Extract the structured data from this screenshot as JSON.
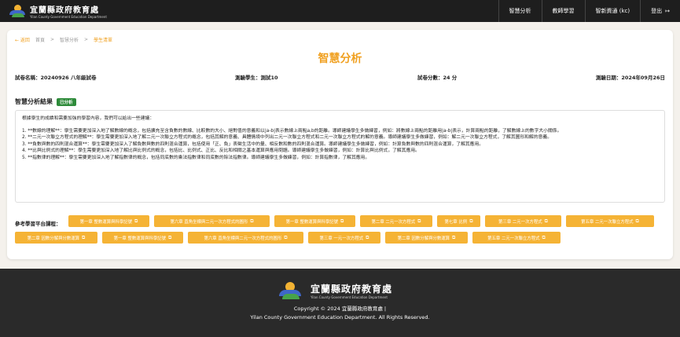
{
  "header": {
    "logo_zh": "宜蘭縣政府教育處",
    "logo_en": "Yilan County Government Education Department",
    "nav": [
      {
        "label": "智慧分析"
      },
      {
        "label": "教師學習"
      },
      {
        "label": "智新資通 (kc)"
      },
      {
        "label": "登出"
      }
    ],
    "logout_icon": "↦"
  },
  "breadcrumb": {
    "back": "← 返回",
    "items": [
      "首頁",
      ">",
      "智慧分析",
      ">",
      "學生清單"
    ]
  },
  "page_title": "智慧分析",
  "meta": {
    "exam_name": "試卷名稱：20240926 八年級試卷",
    "student": "測驗學生：測試10",
    "score": "試卷分數：24 分",
    "date": "測驗日期：2024年09月26日"
  },
  "analysis": {
    "heading": "智慧分析結果",
    "badge": "已分析",
    "intro": "根據學生的成績和需要加強的學習內容，我們可以給出一些建議：",
    "items": [
      "1. **數線的理解**：學生需要更加深入地了解數線的概念，包括擴充至含負數的數線、比較數的大小、絕對值的意義和以|a-b|表示數線上兩點a,b的距離。導師建議學生多做練習，例如：將數線上兩點的距離用|a-b|表示，計算兩點的距離，了解數線上的數字大小關係。",
      "2. **二元一次聯立方程式的理解**：學生需要更加深入地了解二元一次聯立方程式的概念，包括其解的意義、具體情境中列出二元一次聯立方程式和二元一次聯立方程式的解的意義。導師建議學生多做練習，例如：解二元一次聯立方程式，了解其圖形和解的意義。",
      "3. **負數與數的四則混合運算**：學生需要更加深入了解負數與數的四則混合運算，包括使用「正、負」表徵生活中的量、相反數和數的四則混合運算。導師建議學生多做練習，例如：計算負數與數的四則混合運算，了解其應用。",
      "4. **比與比例式的理解**：學生需要更加深入地了解比與比例式的概念，包括比、比例式、正比、反比和相關之基本運算與應用問題。導師建議學生多做練習，例如：計算比與比例式，了解其應用。",
      "5. **指數律的理解**：學生需要更加深入地了解指數律的概念，包括同底數的乘法指數律和同底數的除法指數律。導師建議學生多做練習，例如：計算指數律，了解其應用。"
    ]
  },
  "references": {
    "label": "參考學習平台課程：",
    "buttons": [
      "第一章 整數運算與科學記號",
      "第六章 直角坐標與二元一次方程式的圖形",
      "第一章 整數運算與科學記號",
      "第二章 二元一次方程式",
      "第七章 比例",
      "第三章 二元一次方程式",
      "第五章 二元一次聯立方程式",
      "第二章 因數分解與分數運算",
      "第一章 整數運算與科學記號",
      "第六章 直角坐標與二元一次方程式的圖形",
      "第三章 一元一次方程式",
      "第二章 因數分解與分數運算",
      "第五章 二元一次聯立方程式"
    ],
    "ext_icon": "⧉"
  },
  "footer": {
    "logo_zh": "宜蘭縣政府教育處",
    "logo_en": "Yilan County Government Education Department",
    "copyright_1": "Copyright © 2024 宜蘭縣政府教育處 |",
    "copyright_2": "Yilan County Government Education Department. All Rights Reserved."
  },
  "colors": {
    "accent": "#f0a020",
    "button": "#f5b335",
    "badge": "#2e8b3a",
    "header_bg": "#1e1e1e",
    "footer_bg": "#2a2a2a"
  }
}
